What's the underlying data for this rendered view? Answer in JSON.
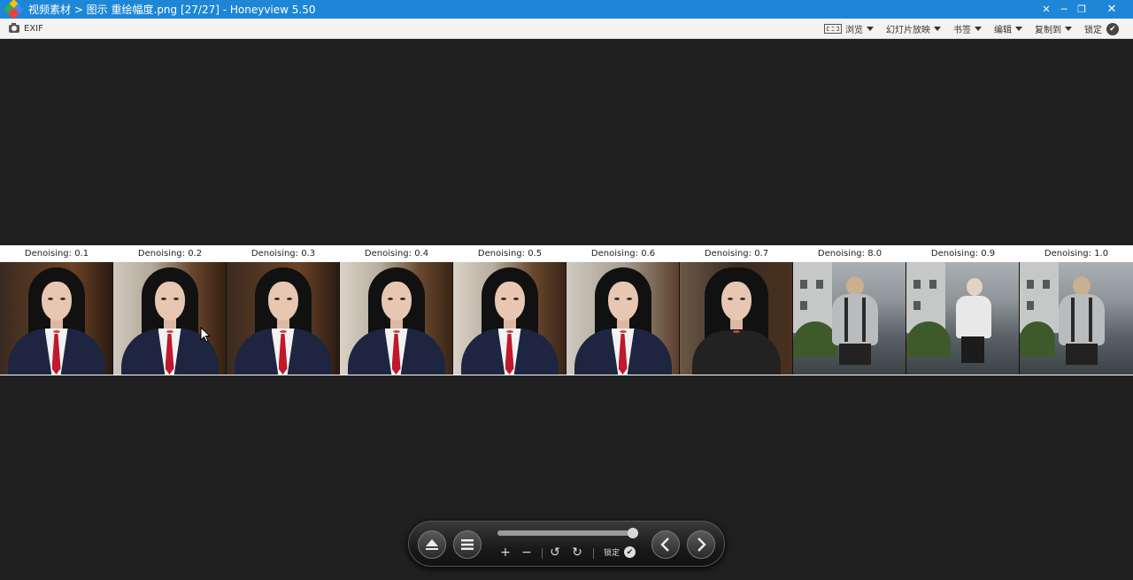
{
  "window": {
    "title": "视频素材 > 图示 重绘幅度.png [27/27] - Honeyview 5.50",
    "controls": {
      "pin": "✕",
      "minimize": "─",
      "restore": "❐",
      "close": "✕"
    }
  },
  "toolbar": {
    "exif_label": "EXIF",
    "items": [
      {
        "label": "浏览"
      },
      {
        "label": "幻灯片放映"
      },
      {
        "label": "书签"
      },
      {
        "label": "编辑"
      },
      {
        "label": "复制到"
      },
      {
        "label": "锁定"
      }
    ]
  },
  "strip": {
    "labels": [
      "Denoising: 0.1",
      "Denoising: 0.2",
      "Denoising: 0.3",
      "Denoising: 0.4",
      "Denoising: 0.5",
      "Denoising: 0.6",
      "Denoising: 0.7",
      "Denoising: 8.0",
      "Denoising: 0.9",
      "Denoising: 1.0"
    ]
  },
  "controlbar": {
    "zoom_in": "+",
    "zoom_out": "−",
    "rotate_left": "↺",
    "rotate_right": "↻",
    "lock_label": "锁定",
    "prev": "‹",
    "next": "›",
    "slider_position": 0.98
  },
  "colors": {
    "titlebar": "#1e86d6",
    "canvas": "#202020",
    "strip": "#ffffff"
  }
}
